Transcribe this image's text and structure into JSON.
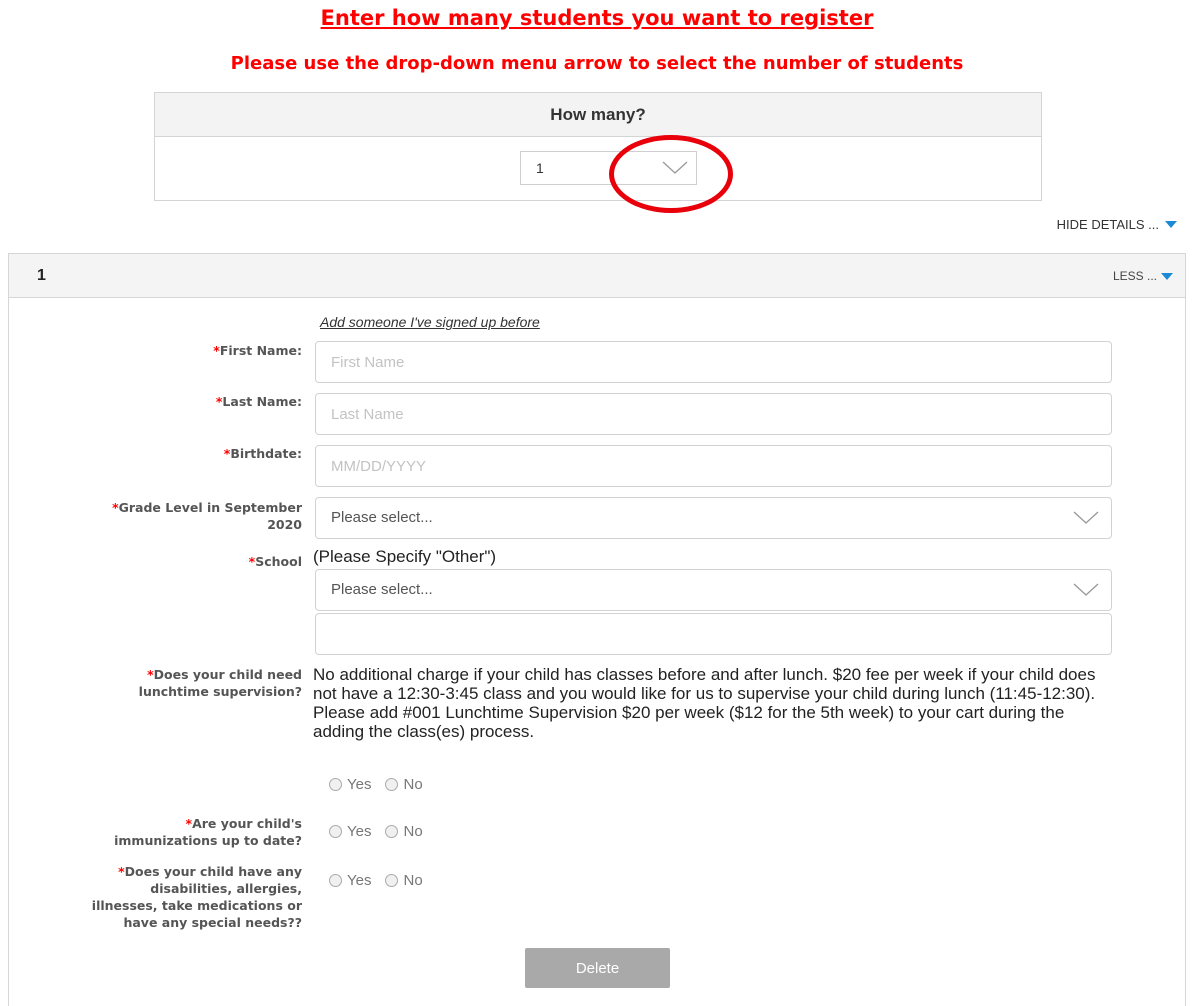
{
  "headings": {
    "title": "Enter how many students you want to register",
    "instruction": "Please use the drop-down menu arrow to select the number of students"
  },
  "howmany": {
    "label": "How many?",
    "selected": "1"
  },
  "toggles": {
    "hide_details": "HIDE DETAILS ...",
    "less": "LESS ..."
  },
  "student": {
    "number": "1",
    "add_link": "Add someone I've signed up before",
    "required_mark": "*",
    "first_name": {
      "label": "First Name:",
      "placeholder": "First Name"
    },
    "last_name": {
      "label": "Last Name:",
      "placeholder": "Last Name"
    },
    "birthdate": {
      "label": "Birthdate:",
      "placeholder": "MM/DD/YYYY"
    },
    "grade": {
      "label_line1": "Grade Level in September",
      "label_line2": "2020",
      "selected": "Please select..."
    },
    "school": {
      "label": "School",
      "note": "(Please Specify \"Other\")",
      "selected": "Please select...",
      "other_value": ""
    },
    "lunch": {
      "label_line1": "Does your child need",
      "label_line2": "lunchtime supervision?",
      "note": "No additional charge if your child has classes before and after lunch. $20 fee per week if your child does not have a 12:30-3:45 class and you would like for us to supervise your child during lunch (11:45-12:30). Please add #001 Lunchtime Supervision $20 per week ($12 for the 5th week) to your cart during the adding the class(es) process."
    },
    "immunizations": {
      "label_line1": "Are your child's",
      "label_line2": "immunizations up to date?"
    },
    "special_needs": {
      "label_line1": "Does your child have any",
      "label_line2": "disabilities, allergies,",
      "label_line3": "illnesses, take medications or",
      "label_line4": "have any special needs??"
    },
    "radio_yes": "Yes",
    "radio_no": "No",
    "delete_label": "Delete"
  },
  "colors": {
    "heading_red": "#ff0000",
    "accent_blue": "#1b8ad6",
    "annotation_circle": "#e8000b",
    "delete_button": "#a9a9a9"
  },
  "icons": [
    "chevron-down-icon",
    "caret-down-icon",
    "radio-icon"
  ]
}
